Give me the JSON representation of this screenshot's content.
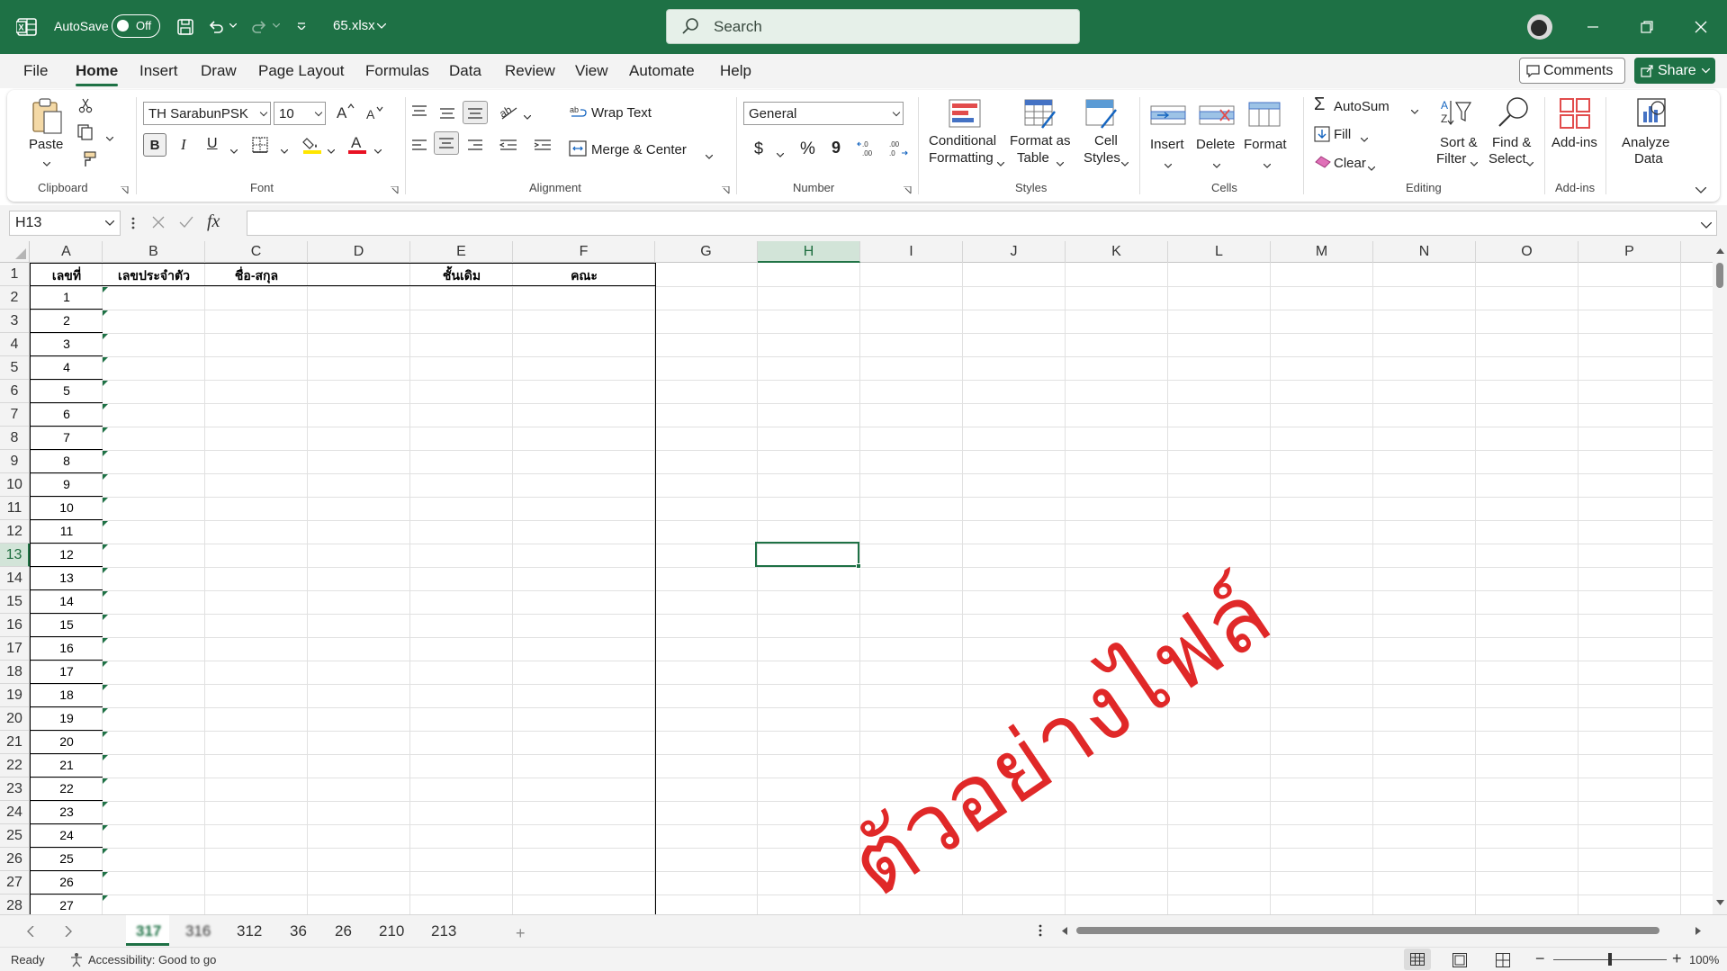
{
  "titlebar": {
    "autosave_label": "AutoSave",
    "autosave_state": "Off",
    "file_name": "65.xlsx",
    "search_placeholder": "Search"
  },
  "menu": [
    "File",
    "Home",
    "Insert",
    "Draw",
    "Page Layout",
    "Formulas",
    "Data",
    "Review",
    "View",
    "Automate",
    "Help"
  ],
  "menu_active": "Home",
  "menu_right": {
    "comments": "Comments",
    "share": "Share"
  },
  "ribbon": {
    "clipboard": {
      "paste": "Paste",
      "group": "Clipboard"
    },
    "font": {
      "name": "TH SarabunPSK",
      "size": "10",
      "bold": "B",
      "italic": "I",
      "underline": "U",
      "group": "Font"
    },
    "alignment": {
      "wrap": "Wrap Text",
      "merge": "Merge & Center",
      "group": "Alignment"
    },
    "number": {
      "format": "General",
      "dollar": "$",
      "percent": "%",
      "comma": "9",
      "group": "Number"
    },
    "styles": {
      "conditional": "Conditional",
      "conditional2": "Formatting",
      "format_table": "Format as",
      "format_table2": "Table",
      "cell_styles": "Cell",
      "cell_styles2": "Styles",
      "group": "Styles"
    },
    "cells": {
      "insert": "Insert",
      "delete": "Delete",
      "format": "Format",
      "group": "Cells"
    },
    "editing": {
      "autosum": "AutoSum",
      "fill": "Fill",
      "clear": "Clear",
      "sort": "Sort &",
      "sort2": "Filter",
      "find": "Find &",
      "find2": "Select",
      "group": "Editing"
    },
    "addins": {
      "addins": "Add-ins",
      "group": "Add-ins"
    },
    "analyze": {
      "label": "Analyze",
      "label2": "Data"
    }
  },
  "formula_bar": {
    "name_box": "H13",
    "fx": "fx",
    "value": ""
  },
  "columns": [
    "A",
    "B",
    "C",
    "D",
    "E",
    "F",
    "G",
    "H",
    "I",
    "J",
    "K",
    "L",
    "M",
    "N",
    "O",
    "P"
  ],
  "selected_column": "H",
  "selected_row": 13,
  "header_row": {
    "A": "เลขที่",
    "B": "เลขประจำตัว",
    "C": "ชื่อ-สกุล",
    "E": "ชั้นเดิม",
    "F": "คณะ"
  },
  "row_numbers": [
    1,
    2,
    3,
    4,
    5,
    6,
    7,
    8,
    9,
    10,
    11,
    12,
    13,
    14,
    15,
    16,
    17,
    18,
    19,
    20,
    21,
    22,
    23,
    24,
    25,
    26,
    27,
    28
  ],
  "col_a_values": [
    1,
    2,
    3,
    4,
    5,
    6,
    7,
    8,
    9,
    10,
    11,
    12,
    13,
    14,
    15,
    16,
    17,
    18,
    19,
    20,
    21,
    22,
    23,
    24,
    25,
    26,
    27
  ],
  "watermark": "ตัวอย่างไฟล์",
  "sheet_tabs": [
    "317",
    "316",
    "312",
    "36",
    "26",
    "210",
    "213"
  ],
  "active_sheet": "317",
  "status": {
    "ready": "Ready",
    "accessibility": "Accessibility: Good to go",
    "zoom": "100%"
  }
}
